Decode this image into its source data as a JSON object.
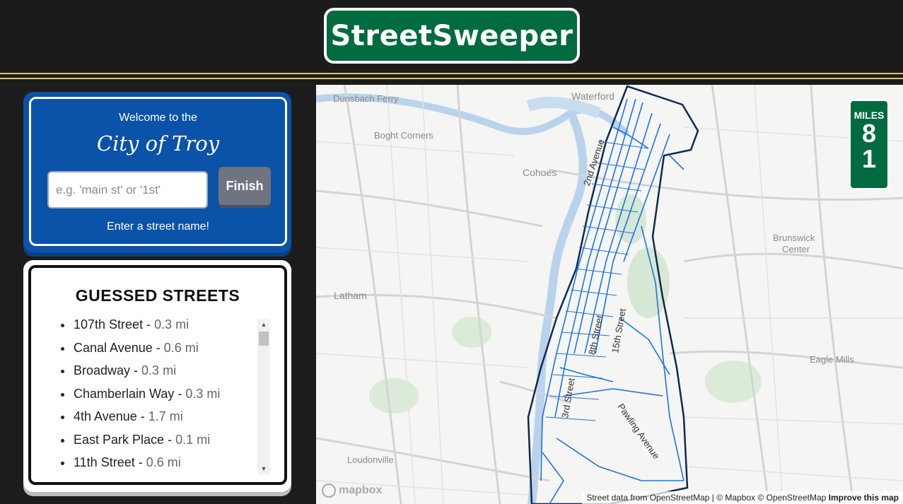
{
  "header": {
    "title": "StreetSweeper"
  },
  "welcome": {
    "line1": "Welcome to the",
    "city": "City of Troy",
    "input_placeholder": "e.g. 'main st' or '1st'",
    "input_value": "",
    "finish_label": "Finish",
    "prompt": "Enter a street name!"
  },
  "guessed": {
    "title": "GUESSED STREETS",
    "items": [
      {
        "name": "107th Street",
        "distance": "0.3 mi"
      },
      {
        "name": "Canal Avenue",
        "distance": "0.6 mi"
      },
      {
        "name": "Broadway",
        "distance": "0.3 mi"
      },
      {
        "name": "Chamberlain Way",
        "distance": "0.3 mi"
      },
      {
        "name": "4th Avenue",
        "distance": "1.7 mi"
      },
      {
        "name": "East Park Place",
        "distance": "0.1 mi"
      },
      {
        "name": "11th Street",
        "distance": "0.6 mi"
      }
    ]
  },
  "miles": {
    "label": "MILES",
    "digit1": "8",
    "digit2": "1"
  },
  "map": {
    "place_labels": {
      "dunsbach": "Dunsbach Ferry",
      "waterford": "Waterford",
      "boght": "Boght Corners",
      "cohoes": "Cohoes",
      "latham": "Latham",
      "brunswick": "Brunswick",
      "center": "Center",
      "eagle": "Eagle Mills",
      "loudonville": "Loudonville"
    },
    "street_labels": {
      "second_ave": "2nd Avenue",
      "eighth_st": "8th Street",
      "fifteenth_st": "15th Street",
      "third_st": "3rd Street",
      "pawling": "Pawling Avenue"
    },
    "attribution": "Street data from OpenStreetMap | © Mapbox © OpenStreetMap",
    "improve": "Improve this map",
    "logo": "mapbox"
  },
  "colors": {
    "sign_green": "#006b3f",
    "sign_blue": "#0b52a9",
    "road_yellow": "#e4c25c",
    "guessed_street_blue": "#1a73e8",
    "boundary_navy": "#0d2a52"
  }
}
